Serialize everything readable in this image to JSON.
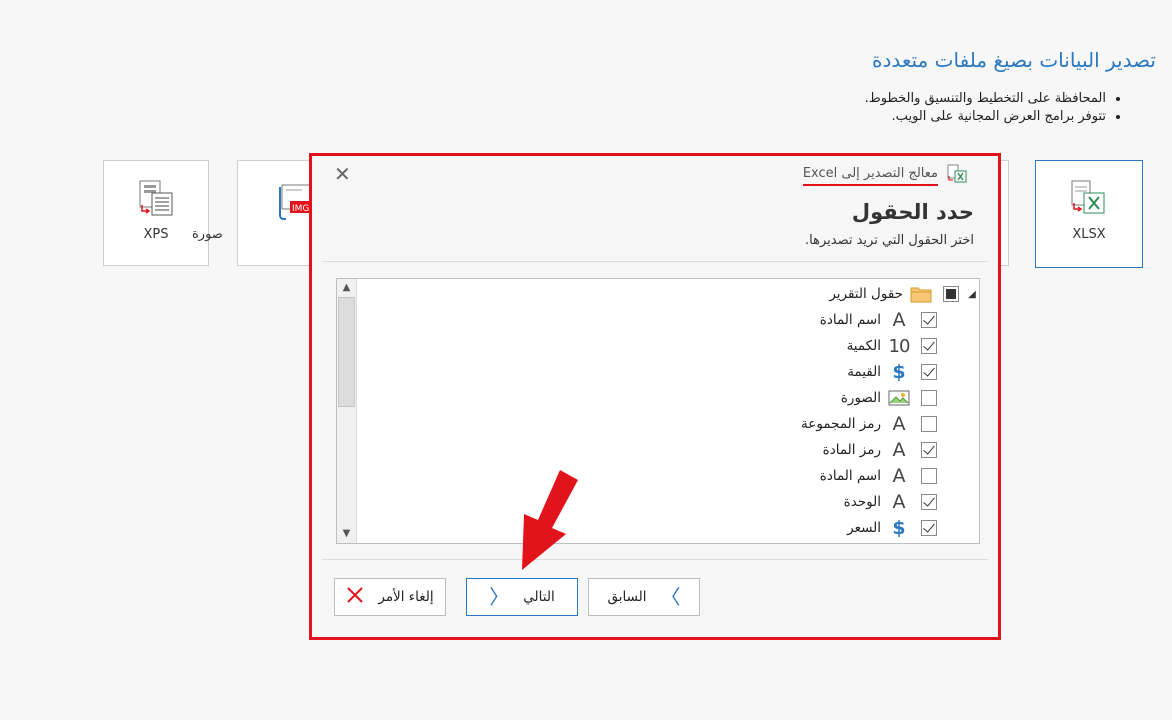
{
  "page": {
    "heading": "تصدير البيانات بصيغ ملفات متعددة",
    "bullets": [
      "المحافظة على التخطيط والتنسيق والخطوط.",
      "تتوفر برامج العرض المجانية على الويب."
    ]
  },
  "formats": [
    {
      "label": "XPS",
      "icon": "xps-document-icon"
    },
    {
      "label": "صورة",
      "icon": "image-export-icon"
    },
    {
      "label": "XLSX",
      "icon": "xlsx-excel-icon",
      "selected": true
    }
  ],
  "dialog": {
    "title": "معالج التصدير إلى Excel",
    "heading": "حدد الحقول",
    "subtitle": "اختر الحقول التي تريد تصديرها.",
    "root": {
      "label": "حقول التقرير",
      "state": "partial",
      "icon": "folder-icon"
    },
    "fields": [
      {
        "label": "اسم المادة",
        "icon": "text-field-icon",
        "checked": true
      },
      {
        "label": "الكمية",
        "icon": "number-field-icon",
        "checked": true
      },
      {
        "label": "القيمة",
        "icon": "currency-field-icon",
        "checked": true
      },
      {
        "label": "الصورة",
        "icon": "image-field-icon",
        "checked": false
      },
      {
        "label": "رمز المجموعة",
        "icon": "text-field-icon",
        "checked": false
      },
      {
        "label": "رمز المادة",
        "icon": "text-field-icon",
        "checked": true
      },
      {
        "label": "اسم المادة",
        "icon": "text-field-icon",
        "checked": false
      },
      {
        "label": "الوحدة",
        "icon": "text-field-icon",
        "checked": true
      },
      {
        "label": "السعر",
        "icon": "currency-field-icon",
        "checked": true
      }
    ],
    "buttons": {
      "back": "السابق",
      "next": "التالي",
      "cancel": "إلغاء الأمر"
    },
    "icon_glyphs": {
      "text": "A",
      "number": "10",
      "currency": "$"
    }
  },
  "colors": {
    "accent": "#2b78c2",
    "highlight": "#e2131a"
  }
}
